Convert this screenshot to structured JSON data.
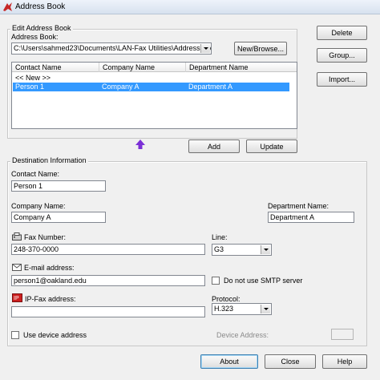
{
  "window": {
    "title": "Address Book"
  },
  "edit_group": {
    "title": "Edit Address Book",
    "address_book_label": "Address Book:",
    "address_book_path": "C:\\Users\\sahmed23\\Documents\\LAN-Fax Utilities\\Address Bo",
    "new_browse_label": "New/Browse...",
    "columns": [
      "Contact Name",
      "Company Name",
      "Department Name"
    ],
    "rows": [
      {
        "contact": "<< New >>",
        "company": "",
        "department": "",
        "selected": false
      },
      {
        "contact": "Person 1",
        "company": "Company A",
        "department": "Department A",
        "selected": true
      }
    ]
  },
  "side_buttons": {
    "delete": "Delete",
    "group": "Group...",
    "import": "Import..."
  },
  "actions": {
    "add": "Add",
    "update": "Update"
  },
  "destination": {
    "title": "Destination Information",
    "contact_name_label": "Contact Name:",
    "contact_name_value": "Person 1",
    "company_name_label": "Company Name:",
    "company_name_value": "Company A",
    "department_name_label": "Department Name:",
    "department_name_value": "Department A",
    "fax_number_label": "Fax Number:",
    "fax_number_value": "248-370-0000",
    "line_label": "Line:",
    "line_value": "G3",
    "email_label": "E-mail address:",
    "email_value": "person1@oakland.edu",
    "no_smtp_label": "Do not use SMTP server",
    "ipfax_label": "IP-Fax address:",
    "ipfax_value": "",
    "protocol_label": "Protocol:",
    "protocol_value": "H.323",
    "use_device_label": "Use device address",
    "device_address_label": "Device Address:"
  },
  "footer": {
    "about": "About",
    "close": "Close",
    "help": "Help"
  },
  "colors": {
    "selection": "#3399ff",
    "arrow": "#7b2fd6",
    "fax_icon_red": "#cc1f1f"
  }
}
